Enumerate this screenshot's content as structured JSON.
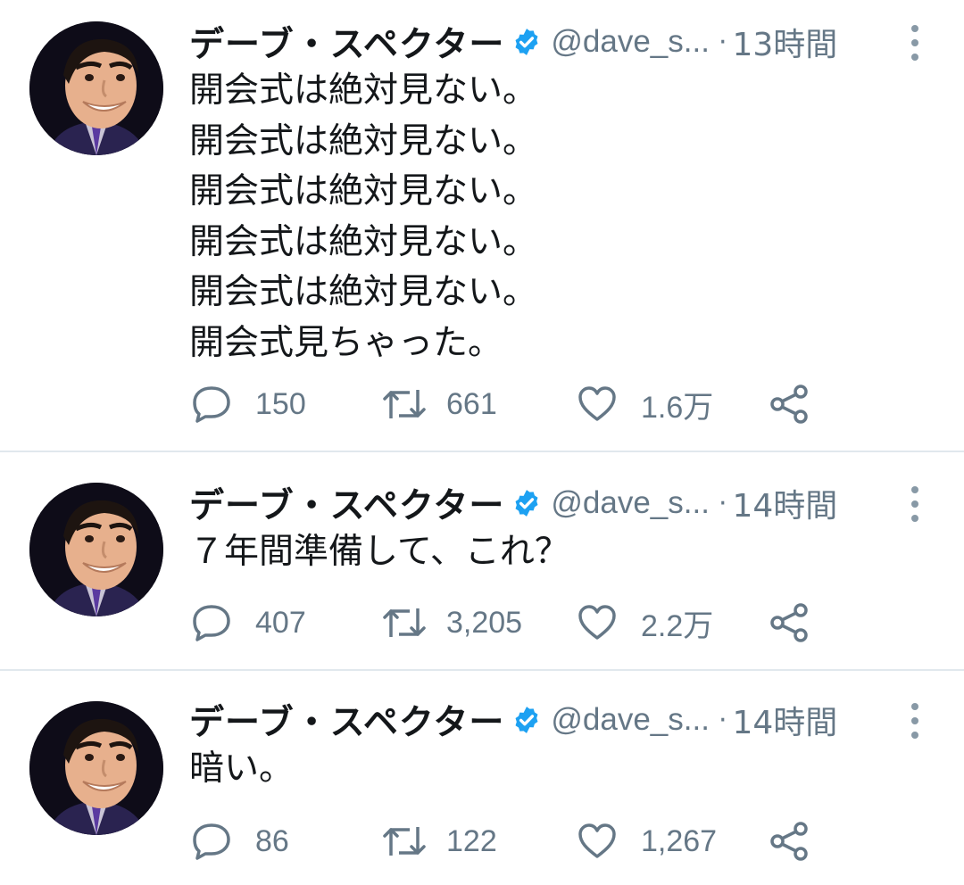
{
  "colors": {
    "accent": "#1da1f2",
    "secondary_text": "#657786",
    "divider": "#e1e8ed"
  },
  "tweets": [
    {
      "author_name": "デーブ・スペクター",
      "handle": "@dave_s...",
      "separator": "·",
      "time": "13時間",
      "verified": true,
      "lines": [
        "開会式は絶対見ない。",
        "開会式は絶対見ない。",
        "開会式は絶対見ない。",
        "開会式は絶対見ない。",
        "開会式は絶対見ない。",
        "開会式見ちゃった。"
      ],
      "replies": "150",
      "retweets": "661",
      "likes": "1.6万"
    },
    {
      "author_name": "デーブ・スペクター",
      "handle": "@dave_s...",
      "separator": "·",
      "time": "14時間",
      "verified": true,
      "lines": [
        "７年間準備して、これ？"
      ],
      "replies": "407",
      "retweets": "3,205",
      "likes": "2.2万"
    },
    {
      "author_name": "デーブ・スペクター",
      "handle": "@dave_s...",
      "separator": "·",
      "time": "14時間",
      "verified": true,
      "lines": [
        "暗い。"
      ],
      "replies": "86",
      "retweets": "122",
      "likes": "1,267"
    }
  ]
}
